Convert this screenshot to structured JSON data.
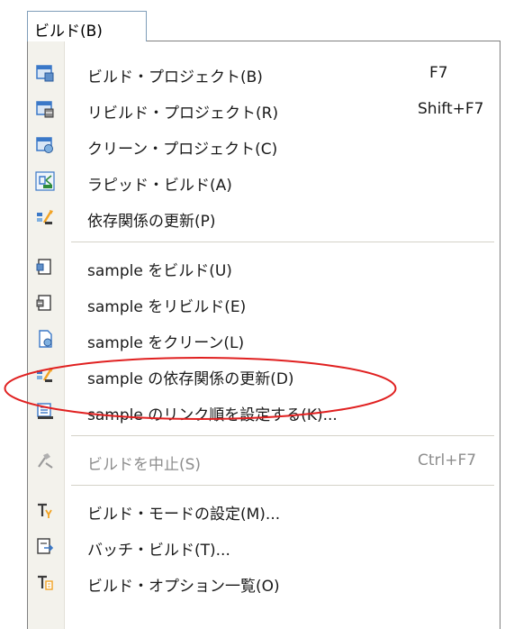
{
  "menubar": {
    "tab_label": "ビルド(B)"
  },
  "menu": {
    "items": [
      {
        "label": "ビルド・プロジェクト(B)",
        "shortcut": "F7",
        "icon": "build-project-icon",
        "enabled": true
      },
      {
        "label": "リビルド・プロジェクト(R)",
        "shortcut": "Shift+F7",
        "icon": "rebuild-project-icon",
        "enabled": true
      },
      {
        "label": "クリーン・プロジェクト(C)",
        "shortcut": "",
        "icon": "clean-project-icon",
        "enabled": true
      },
      {
        "label": "ラピッド・ビルド(A)",
        "shortcut": "",
        "icon": "rapid-build-icon",
        "enabled": true
      },
      {
        "label": "依存関係の更新(P)",
        "shortcut": "",
        "icon": "update-dependencies-icon",
        "enabled": true
      },
      {
        "label": "sample をビルド(U)",
        "shortcut": "",
        "icon": "build-file-icon",
        "enabled": true
      },
      {
        "label": "sample をリビルド(E)",
        "shortcut": "",
        "icon": "rebuild-file-icon",
        "enabled": true
      },
      {
        "label": "sample をクリーン(L)",
        "shortcut": "",
        "icon": "clean-file-icon",
        "enabled": true
      },
      {
        "label": "sample の依存関係の更新(D)",
        "shortcut": "",
        "icon": "update-dependencies-icon",
        "enabled": true,
        "highlighted": true
      },
      {
        "label": "sample のリンク順を設定する(K)...",
        "shortcut": "",
        "icon": "link-order-icon",
        "enabled": true
      },
      {
        "label": "ビルドを中止(S)",
        "shortcut": "Ctrl+F7",
        "icon": "stop-build-icon",
        "enabled": false
      },
      {
        "label": "ビルド・モードの設定(M)...",
        "shortcut": "",
        "icon": "build-mode-icon",
        "enabled": true
      },
      {
        "label": "バッチ・ビルド(T)...",
        "shortcut": "",
        "icon": "batch-build-icon",
        "enabled": true
      },
      {
        "label": "ビルド・オプション一覧(O)",
        "shortcut": "",
        "icon": "build-options-list-icon",
        "enabled": true
      }
    ]
  },
  "annotation": {
    "color": "#e02020"
  },
  "colors": {
    "icon_blue": "#3a78c8",
    "icon_dark": "#3b3b3b",
    "icon_orange": "#f2a324",
    "disabled_text": "#8d8d8d"
  }
}
